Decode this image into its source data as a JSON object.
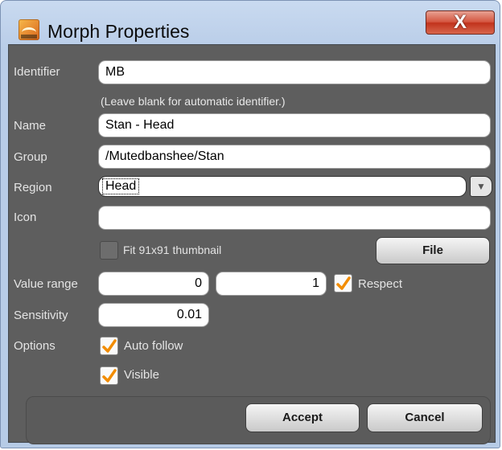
{
  "window": {
    "title": "Morph Properties",
    "close_label": "X"
  },
  "form": {
    "identifier": {
      "label": "Identifier",
      "value": "MB",
      "hint": "(Leave blank for automatic identifier.)"
    },
    "name": {
      "label": "Name",
      "value": "Stan - Head"
    },
    "group": {
      "label": "Group",
      "value": "/Mutedbanshee/Stan"
    },
    "region": {
      "label": "Region",
      "value": "Head"
    },
    "icon": {
      "label": "Icon",
      "value": "",
      "thumbnail_label": "Fit 91x91 thumbnail",
      "thumbnail_checked": false,
      "file_button": "File"
    },
    "value_range": {
      "label": "Value range",
      "min": "0",
      "max": "1",
      "respect_label": "Respect",
      "respect_checked": true
    },
    "sensitivity": {
      "label": "Sensitivity",
      "value": "0.01"
    },
    "options": {
      "label": "Options",
      "auto_follow_label": "Auto follow",
      "auto_follow_checked": true,
      "visible_label": "Visible",
      "visible_checked": true
    }
  },
  "footer": {
    "accept": "Accept",
    "cancel": "Cancel"
  },
  "colors": {
    "check_orange": "#f28c00",
    "panel": "#5e5e5e",
    "label": "#e4e4e4",
    "close_red": "#c1321c"
  },
  "icons": [
    "app-icon",
    "close-icon",
    "dropdown-arrow-icon",
    "checkmark-icon"
  ]
}
